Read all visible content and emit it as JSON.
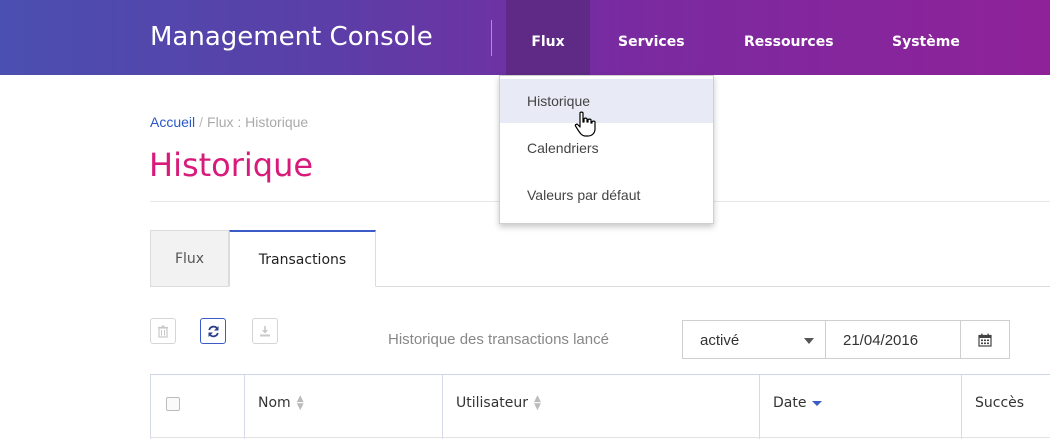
{
  "header": {
    "brand": "Management Console",
    "nav": [
      "Flux",
      "Services",
      "Ressources",
      "Système"
    ],
    "active_nav": "Flux",
    "gradient_start": "#4b4fb0",
    "gradient_end": "#8f2299"
  },
  "dropdown": {
    "items": [
      "Historique",
      "Calendriers",
      "Valeurs par défaut"
    ],
    "hovered": "Historique"
  },
  "breadcrumb": {
    "home": "Accueil",
    "separator": "/",
    "current": "Flux : Historique"
  },
  "page": {
    "title": "Historique",
    "title_color": "#d81b7a"
  },
  "tabs": {
    "items": [
      "Flux",
      "Transactions"
    ],
    "active": "Transactions"
  },
  "toolbar": {
    "icons": [
      "trash-icon",
      "refresh-icon",
      "download-icon"
    ],
    "filter_label": "Historique des transactions lancé",
    "filter_value": "activé",
    "date_value": "21/04/2016",
    "calendar_icon": "calendar-icon"
  },
  "table": {
    "columns": [
      "Nom",
      "Utilisateur",
      "Date",
      "Succès"
    ],
    "sorted_column": "Date",
    "sort_direction": "descending"
  }
}
